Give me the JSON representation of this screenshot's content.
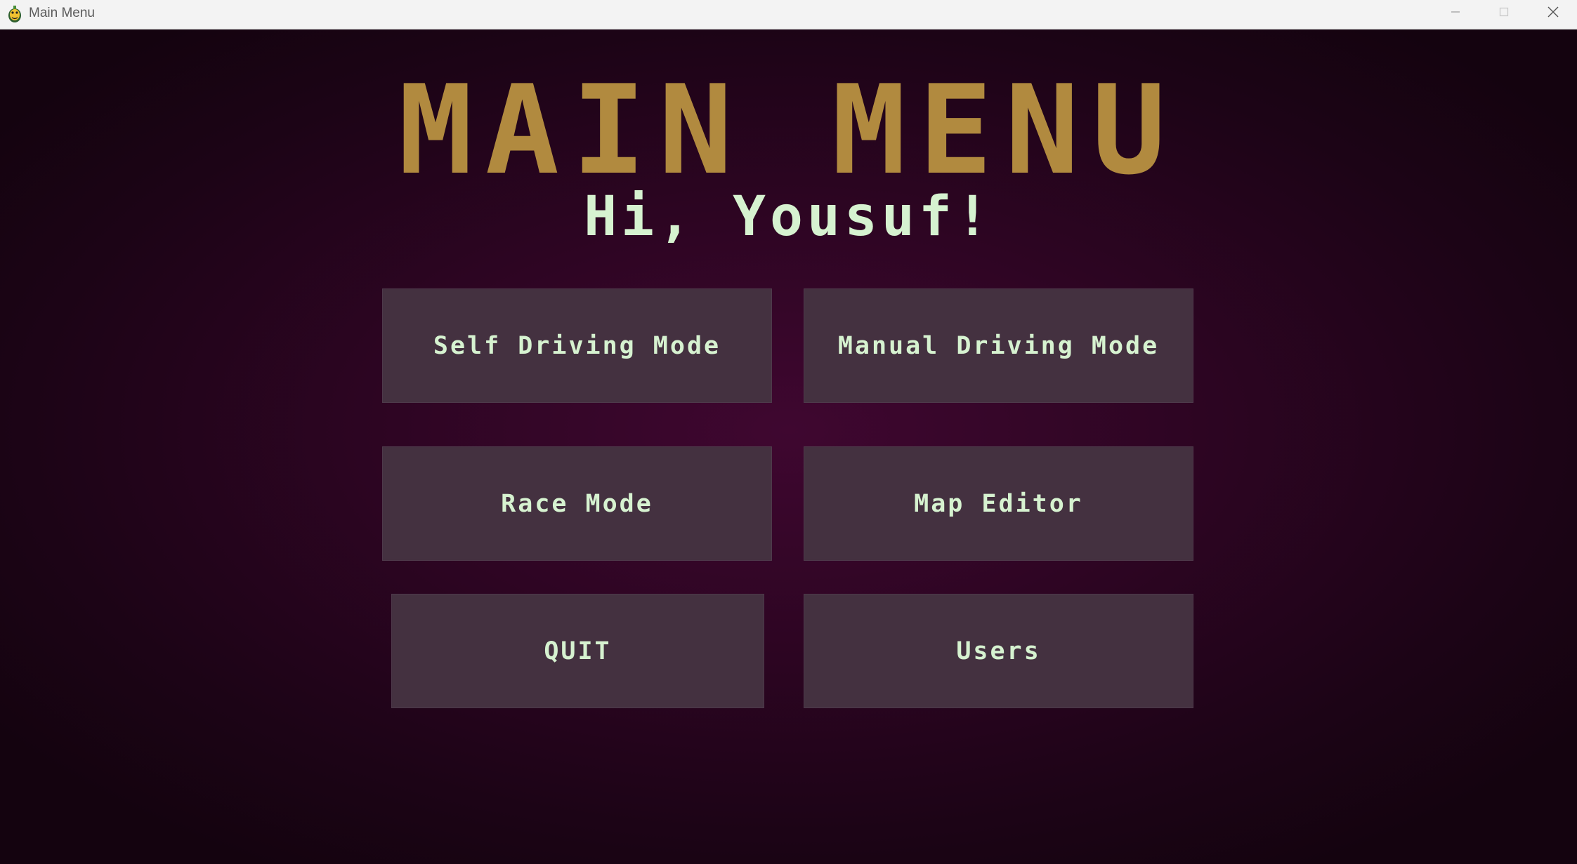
{
  "window": {
    "title": "Main Menu",
    "icon": "pygame-snake-icon",
    "controls": [
      "minimize-icon",
      "maximize-icon",
      "close-icon"
    ]
  },
  "screen": {
    "title": "MAIN MENU",
    "greeting": "Hi, Yousuf!"
  },
  "buttons": {
    "self_driving": "Self Driving Mode",
    "manual_driving": "Manual Driving Mode",
    "race": "Race Mode",
    "map_editor": "Map Editor",
    "quit": "QUIT",
    "users": "Users"
  },
  "colors": {
    "title": "#b18a3f",
    "text": "#d6f2d0",
    "button_bg": "#443140",
    "background": "#2e0523"
  }
}
